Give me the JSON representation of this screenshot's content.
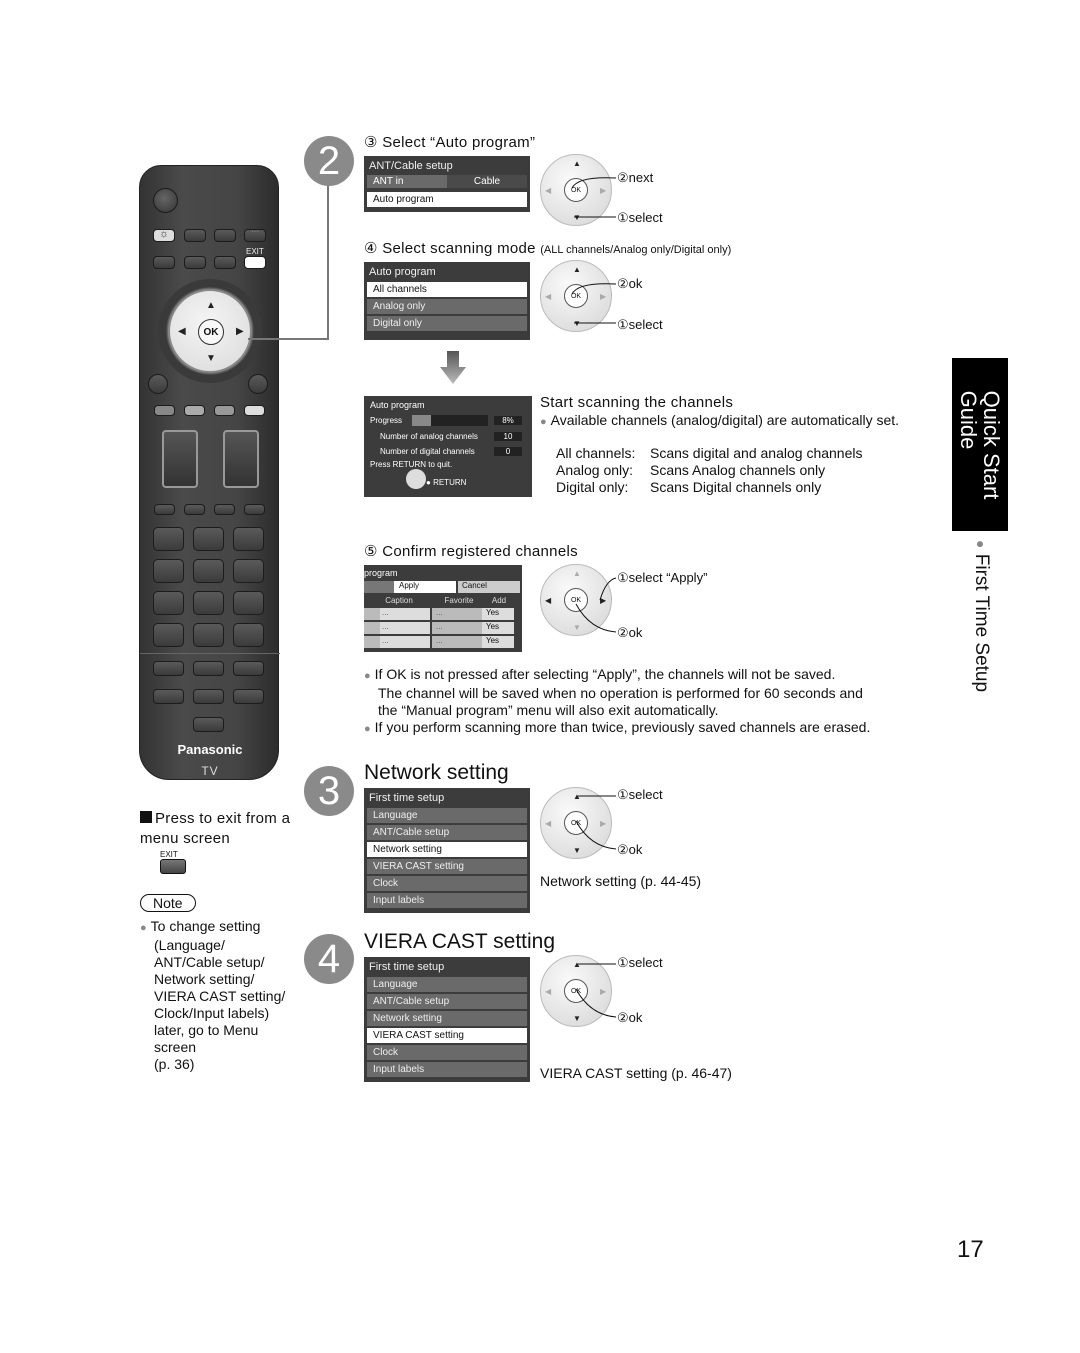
{
  "page_number": "17",
  "side_tab": {
    "title_line1": "Quick Start",
    "title_line2": "Guide",
    "subtitle": "First Time Setup"
  },
  "remote": {
    "brand": "Panasonic",
    "model_label": "TV",
    "exit_label": "EXIT",
    "ok_label": "OK"
  },
  "exit_note": {
    "heading": "Press to exit from a menu screen",
    "exit_label": "EXIT"
  },
  "note": {
    "badge": "Note",
    "lines": [
      "To change setting",
      "(Language/",
      "ANT/Cable setup/",
      "Network setting/",
      "VIERA CAST setting/",
      "Clock/Input labels)",
      "later, go to Menu",
      "screen",
      "(p. 36)"
    ]
  },
  "step2": {
    "number": "2",
    "sub3": {
      "heading": "③ Select “Auto program”",
      "menu": {
        "title": "ANT/Cable setup",
        "row1_label": "ANT in",
        "row1_value": "Cable",
        "row2": "Auto program"
      },
      "callout_top": "②next",
      "callout_bottom": "①select"
    },
    "sub4": {
      "heading": "④ Select scanning mode",
      "heading_note": "(ALL channels/Analog only/Digital only)",
      "menu": {
        "title": "Auto program",
        "items": [
          "All channels",
          "Analog only",
          "Digital only"
        ],
        "selected": 0
      },
      "callout_top": "②ok",
      "callout_bottom": "①select"
    },
    "scan": {
      "menu": {
        "title": "Auto program",
        "progress_label": "Progress",
        "progress_value": "8%",
        "progress_fraction": 0.08,
        "analog_label": "Number of analog channels",
        "analog_value": "10",
        "digital_label": "Number of digital channels",
        "digital_value": "0",
        "quit_hint": "Press RETURN to quit.",
        "return_label": "RETURN"
      },
      "heading": "Start scanning the channels",
      "bullet": "Available channels (analog/digital) are automatically set.",
      "modes": [
        {
          "name": "All channels:",
          "desc": "Scans digital and analog channels"
        },
        {
          "name": "Analog only:",
          "desc": "Scans Analog channels only"
        },
        {
          "name": "Digital only:",
          "desc": "Scans Digital channels only"
        }
      ]
    },
    "sub5": {
      "heading": "⑤ Confirm registered channels",
      "menu": {
        "title": "program",
        "apply": "Apply",
        "cancel": "Cancel",
        "columns": [
          "Caption",
          "Favorite",
          "Add"
        ],
        "rows": [
          [
            "...",
            "...",
            "Yes"
          ],
          [
            "...",
            "...",
            "Yes"
          ],
          [
            "...",
            "...",
            "Yes"
          ]
        ]
      },
      "callout_top": "①select “Apply”",
      "callout_bottom": "②ok"
    },
    "notes": [
      "If OK is not pressed after selecting “Apply”, the channels will not be saved.",
      "The channel will be saved when no operation is performed for 60 seconds and",
      "the “Manual program” menu will also exit automatically.",
      "If you perform scanning more than twice, previously saved channels are erased."
    ]
  },
  "step3": {
    "number": "3",
    "heading": "Network setting",
    "menu": {
      "title": "First time setup",
      "items": [
        "Language",
        "ANT/Cable setup",
        "Network setting",
        "VIERA CAST setting",
        "Clock",
        "Input labels"
      ],
      "selected": 2
    },
    "callout_top": "①select",
    "callout_bottom": "②ok",
    "reference": "Network setting (p. 44-45)"
  },
  "step4": {
    "number": "4",
    "heading": "VIERA CAST setting",
    "menu": {
      "title": "First time setup",
      "items": [
        "Language",
        "ANT/Cable setup",
        "Network setting",
        "VIERA CAST setting",
        "Clock",
        "Input labels"
      ],
      "selected": 3
    },
    "callout_top": "①select",
    "callout_bottom": "②ok",
    "reference": "VIERA CAST setting (p. 46-47)"
  }
}
